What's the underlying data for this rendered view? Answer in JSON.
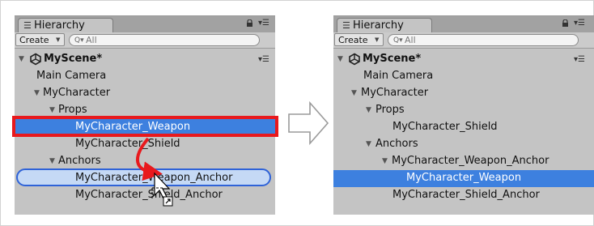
{
  "left": {
    "tab_title": "Hierarchy",
    "create_label": "Create",
    "search_placeholder": "All",
    "scene_name": "MyScene*",
    "rows": [
      {
        "label": "Main Camera"
      },
      {
        "label": "MyCharacter"
      },
      {
        "label": "Props"
      },
      {
        "label": "MyCharacter_Weapon",
        "selected": true
      },
      {
        "label": "MyCharacter_Shield"
      },
      {
        "label": "Anchors"
      },
      {
        "label": "MyCharacter_Weapon_Anchor",
        "drop_target": true
      },
      {
        "label": "MyCharacter_Shield_Anchor"
      }
    ]
  },
  "right": {
    "tab_title": "Hierarchy",
    "create_label": "Create",
    "search_placeholder": "All",
    "scene_name": "MyScene*",
    "rows": [
      {
        "label": "Main Camera"
      },
      {
        "label": "MyCharacter"
      },
      {
        "label": "Props"
      },
      {
        "label": "MyCharacter_Shield"
      },
      {
        "label": "Anchors"
      },
      {
        "label": "MyCharacter_Weapon_Anchor"
      },
      {
        "label": "MyCharacter_Weapon",
        "selected": true
      },
      {
        "label": "MyCharacter_Shield_Anchor"
      }
    ]
  },
  "icons": {
    "tab": "hierarchy-list-icon",
    "lock": "lock-icon",
    "panel_menu": "panel-menu-icon",
    "scene": "unity-scene-icon",
    "search": "search-icon",
    "transition": "right-arrow-icon",
    "drag_cursor": "drag-cursor-icon"
  },
  "colors": {
    "selection": "#3d80df",
    "highlight_border": "#e8191d",
    "drop_target_border": "#2f63d8",
    "drag_arrow": "#e8191d"
  }
}
